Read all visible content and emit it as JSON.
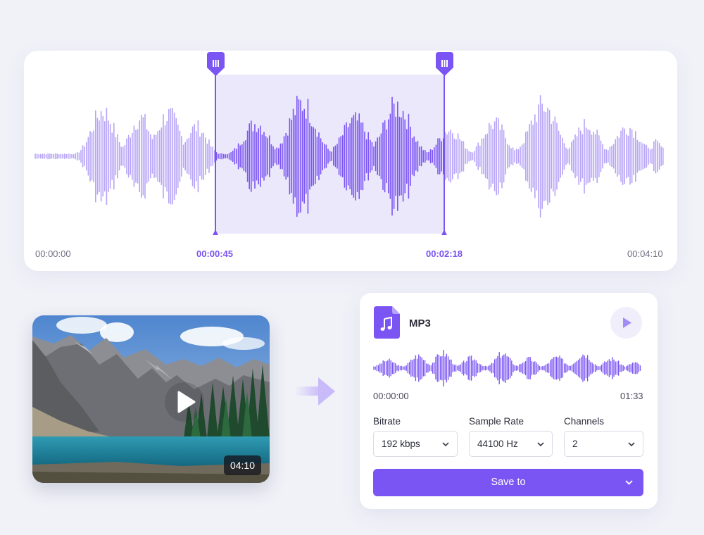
{
  "editor": {
    "selection": {
      "start": "00:00:45",
      "end": "00:02:18"
    },
    "time_labels": {
      "start": "00:00:00",
      "sel_start": "00:00:45",
      "sel_end": "00:02:18",
      "end": "00:04:10"
    },
    "colors": {
      "wave_light": "#b7a4f7",
      "wave_selected": "#7b55f3",
      "selection_fill": "#ece8fc",
      "handle": "#7b55f3",
      "time_accent": "#7a52f0"
    }
  },
  "video": {
    "duration": "04:10",
    "play_icon": "play-icon"
  },
  "arrow_icon": "arrow-right-icon",
  "export": {
    "format": "MP3",
    "file_icon": "music-file-icon",
    "preview_play_icon": "play-icon",
    "time_start": "00:00:00",
    "time_end": "01:33",
    "fields": {
      "bitrate": {
        "label": "Bitrate",
        "value": "192 kbps"
      },
      "sample_rate": {
        "label": "Sample Rate",
        "value": "44100 Hz"
      },
      "channels": {
        "label": "Channels",
        "value": "2"
      }
    },
    "save_label": "Save to",
    "accent": "#7b55f3"
  }
}
